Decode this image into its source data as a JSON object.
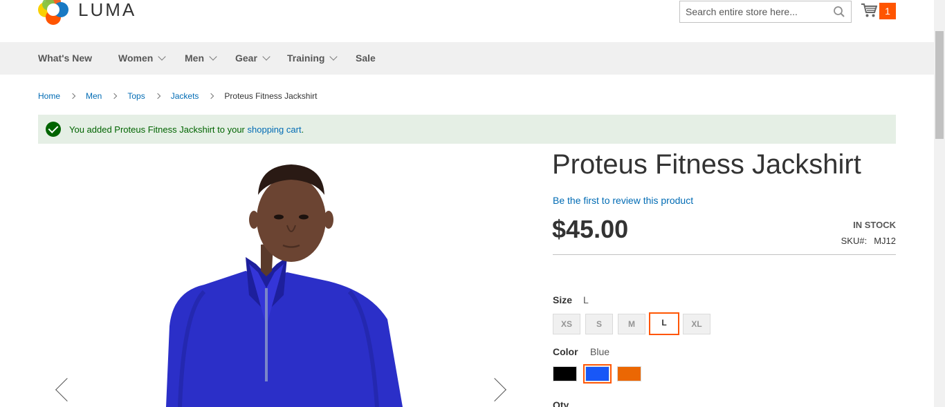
{
  "header": {
    "logo_text": "LUMA",
    "search_placeholder": "Search entire store here...",
    "cart_count": "1"
  },
  "nav": {
    "items": [
      {
        "label": "What's New",
        "has_dropdown": false
      },
      {
        "label": "Women",
        "has_dropdown": true
      },
      {
        "label": "Men",
        "has_dropdown": true
      },
      {
        "label": "Gear",
        "has_dropdown": true
      },
      {
        "label": "Training",
        "has_dropdown": true
      },
      {
        "label": "Sale",
        "has_dropdown": false
      }
    ]
  },
  "breadcrumb": {
    "items": [
      "Home",
      "Men",
      "Tops",
      "Jackets"
    ],
    "current": "Proteus Fitness Jackshirt"
  },
  "message": {
    "text_before": "You added Proteus Fitness Jackshirt to your ",
    "link": "shopping cart",
    "text_after": "."
  },
  "product": {
    "title": "Proteus Fitness Jackshirt",
    "review_link": "Be the first to review this product",
    "price": "$45.00",
    "stock": "IN STOCK",
    "sku_label": "SKU#:",
    "sku_value": "MJ12"
  },
  "options": {
    "size_label": "Size",
    "size_selected": "L",
    "sizes": [
      "XS",
      "S",
      "M",
      "L",
      "XL"
    ],
    "color_label": "Color",
    "color_selected": "Blue",
    "colors": [
      "#000000",
      "#1857f7",
      "#eb6703"
    ]
  },
  "qty_label": "Qty",
  "colors": {
    "accent": "#ff5501",
    "link": "#006bb4",
    "success_bg": "#e5efe5",
    "success_text": "#006400"
  }
}
